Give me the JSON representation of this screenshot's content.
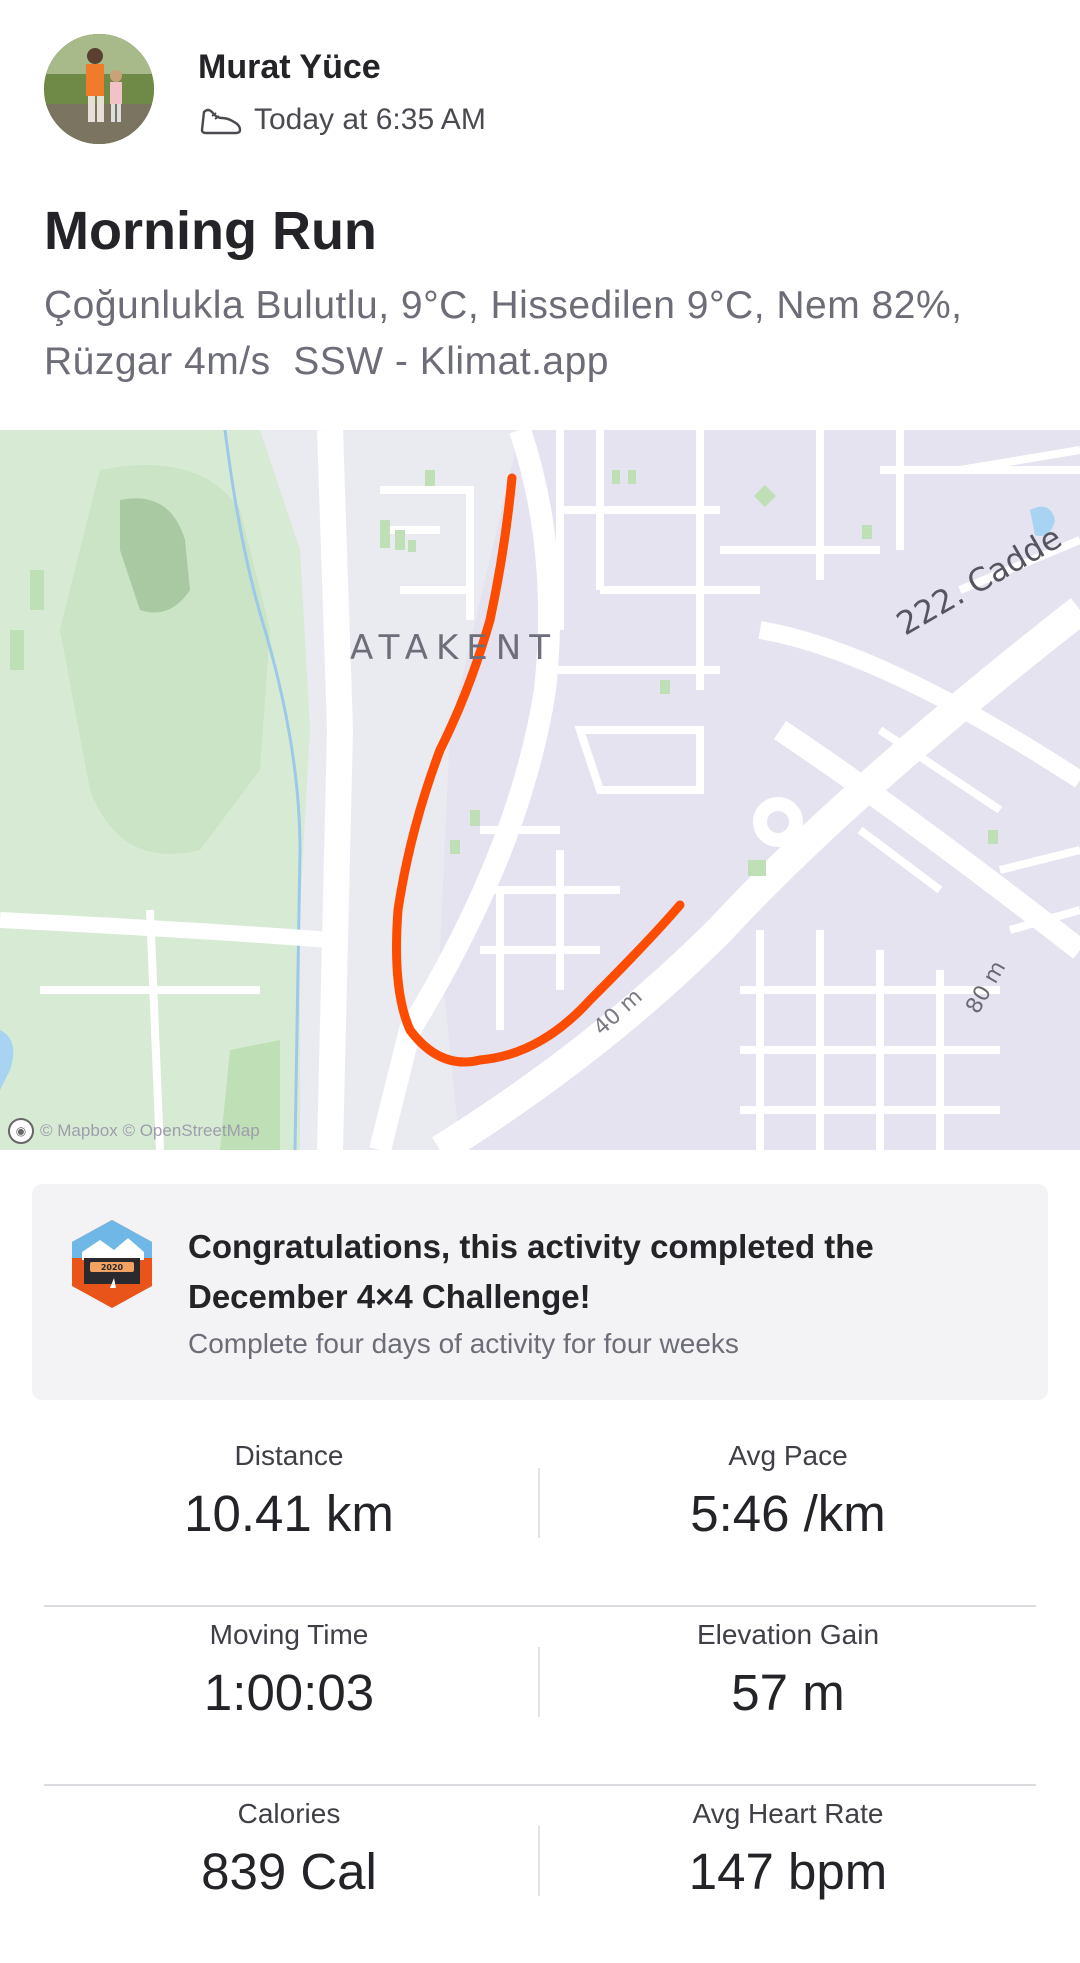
{
  "athlete": {
    "name": "Murat Yüce",
    "timestamp": "Today at 6:35 AM"
  },
  "activity": {
    "title": "Morning Run",
    "description": "Çoğunlukla Bulutlu, 9°C, Hissedilen 9°C, Nem 82%,\nRüzgar 4m/s  SSW - Klimat.app"
  },
  "map": {
    "district_label": "ATAKENT",
    "street_label": "222. Cadde",
    "road_label_40": "40 m",
    "road_label_80": "80 m",
    "attribution": "© Mapbox © OpenStreetMap",
    "route_color": "#fc4c02"
  },
  "challenge": {
    "badge_year": "2020",
    "title": "Congratulations, this activity completed the December 4×4 Challenge!",
    "subtitle": "Complete four days of activity for four weeks"
  },
  "stats": [
    {
      "label": "Distance",
      "value": "10.41 km"
    },
    {
      "label": "Avg Pace",
      "value": "5:46 /km"
    },
    {
      "label": "Moving Time",
      "value": "1:00:03"
    },
    {
      "label": "Elevation Gain",
      "value": "57 m"
    },
    {
      "label": "Calories",
      "value": "839 Cal"
    },
    {
      "label": "Avg Heart Rate",
      "value": "147 bpm"
    }
  ],
  "colors": {
    "brand_orange": "#fc4c02",
    "text_primary": "#242428",
    "text_secondary": "#6d6d78"
  }
}
